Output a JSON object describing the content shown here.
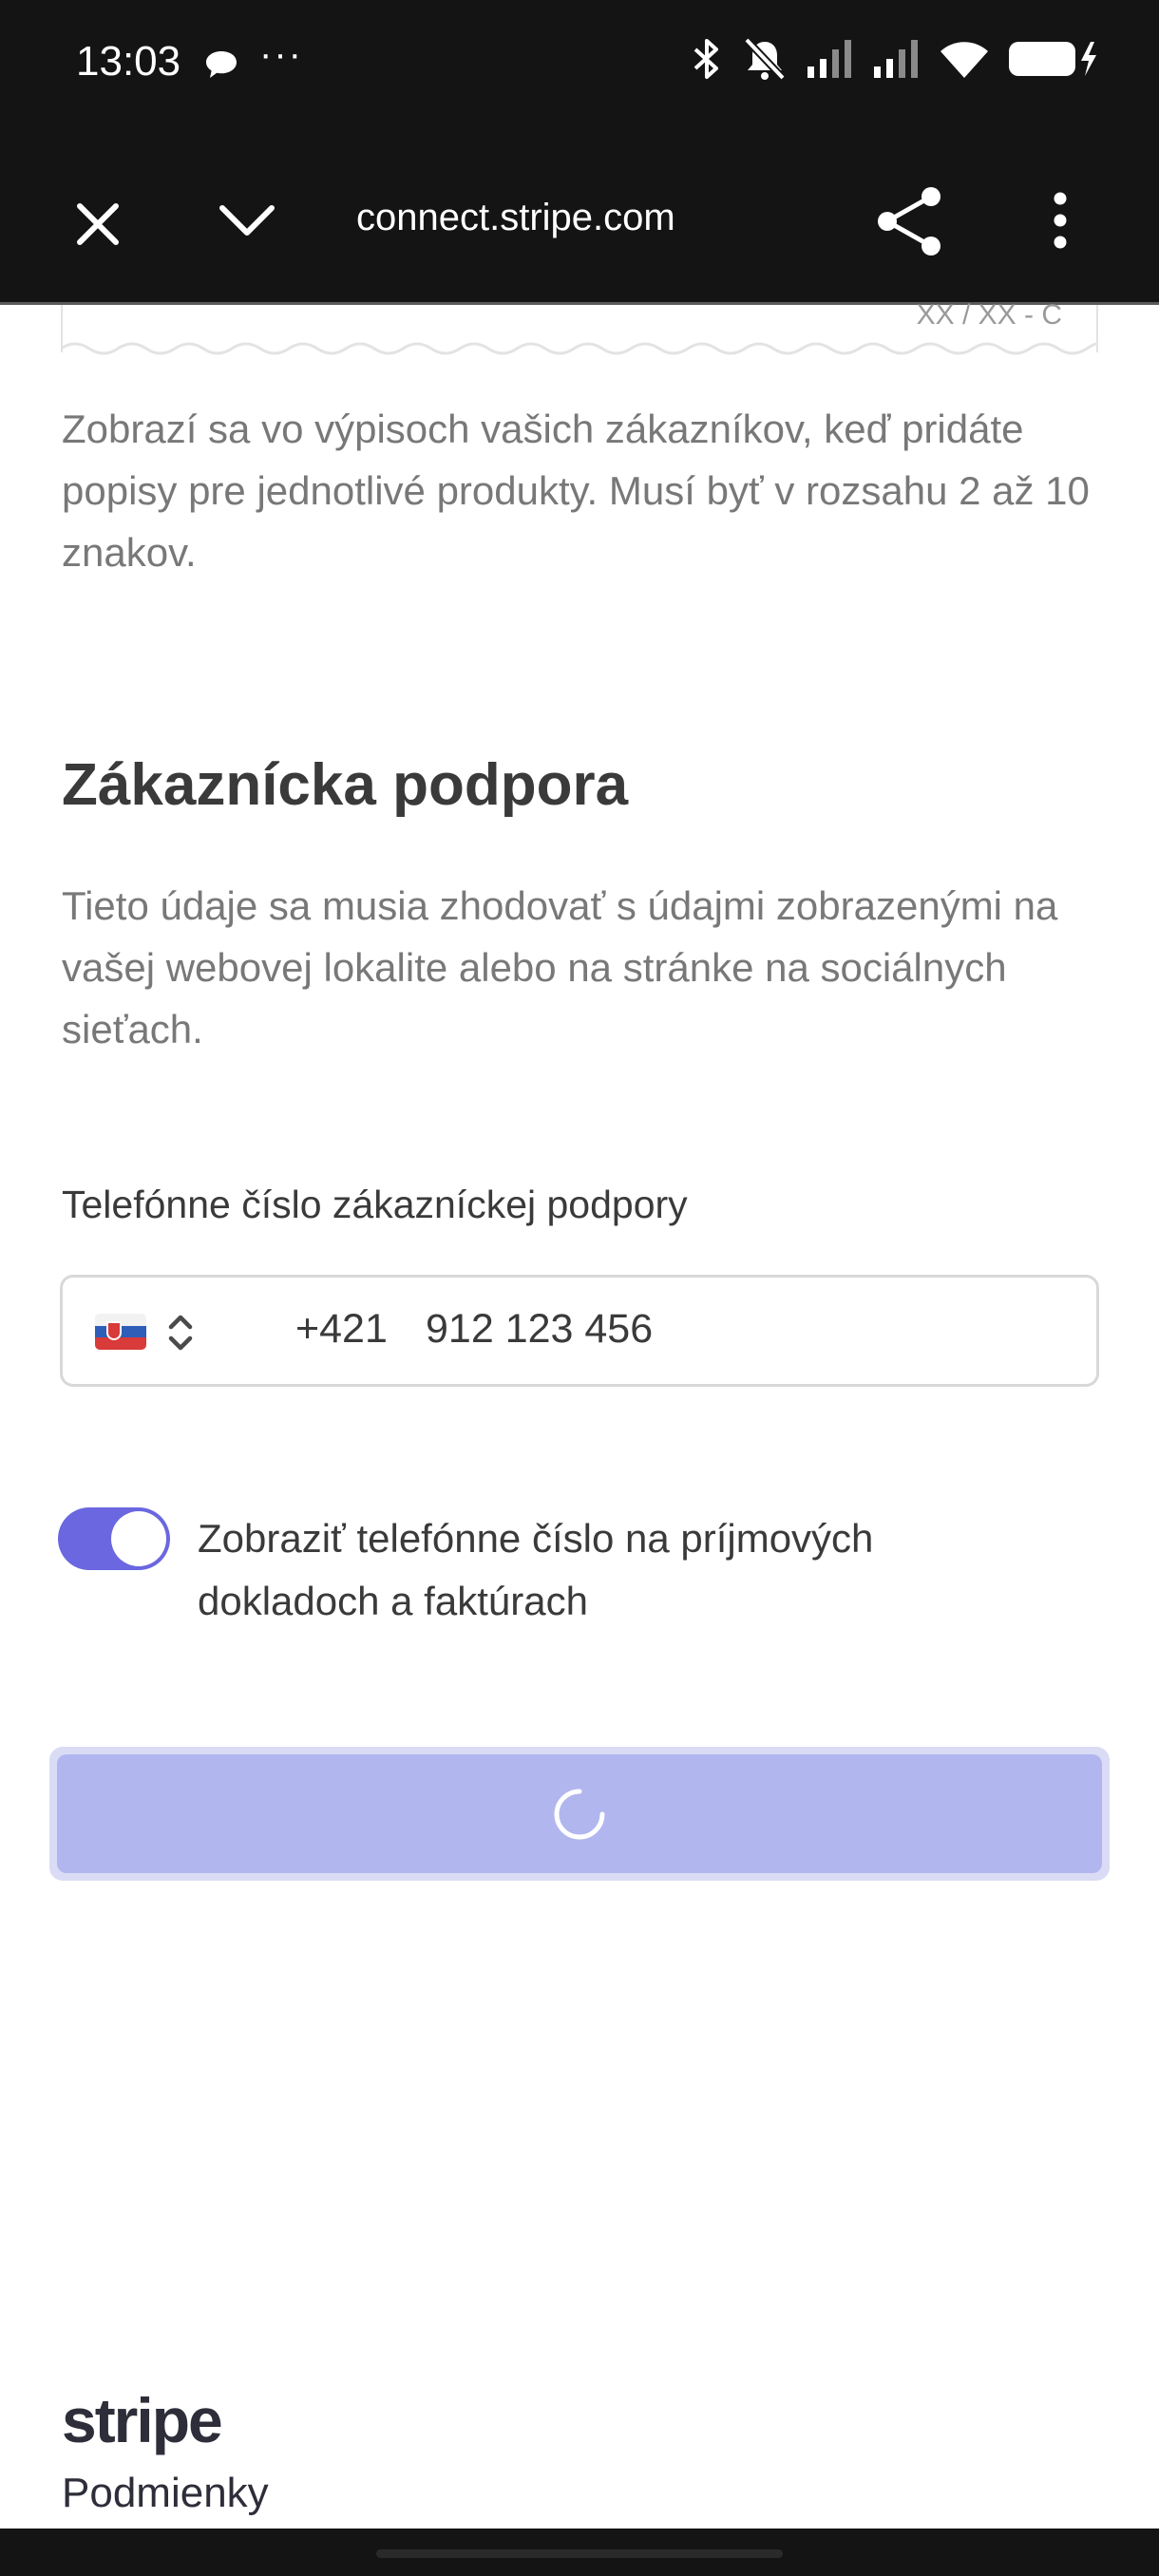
{
  "status_bar": {
    "time": "13:03",
    "icons": [
      "chat-icon",
      "more-dots-icon",
      "bluetooth-icon",
      "silent-icon",
      "signal-icon",
      "signal-icon",
      "wifi-icon",
      "battery-charging-icon"
    ],
    "more": "···"
  },
  "browser": {
    "url": "connect.stripe.com",
    "close_icon": "close-icon",
    "collapse_icon": "chevron-down-icon",
    "share_icon": "share-icon",
    "menu_icon": "overflow-menu-icon"
  },
  "statement": {
    "prev_fragment": "XX / XX - C",
    "hint": "Zobrazí sa vo výpisoch vašich zákazníkov, keď pridáte popisy pre jednotlivé produkty. Musí byť v rozsahu 2 až 10 znakov."
  },
  "support": {
    "heading": "Zákaznícka podpora",
    "description": "Tieto údaje sa musia zhodovať s údajmi zobrazenými na vašej webovej lokalite alebo na stránke na sociálnych sieťach.",
    "phone_label": "Telefónne číslo zákazníckej podpory",
    "country": "Slovakia",
    "dial_code": "+421",
    "phone_placeholder": "912 123 456",
    "toggle_label": "Zobraziť telefónne číslo na príjmových dokladoch a faktúrach",
    "toggle_on": true
  },
  "submit": {
    "state": "loading"
  },
  "footer": {
    "logo": "stripe",
    "terms": "Podmienky"
  },
  "colors": {
    "accent": "#6a67e0",
    "button_loading": "#b1b6ee",
    "system_bar": "#141414",
    "text_muted": "#787878",
    "text_main": "#3a3a3a"
  }
}
